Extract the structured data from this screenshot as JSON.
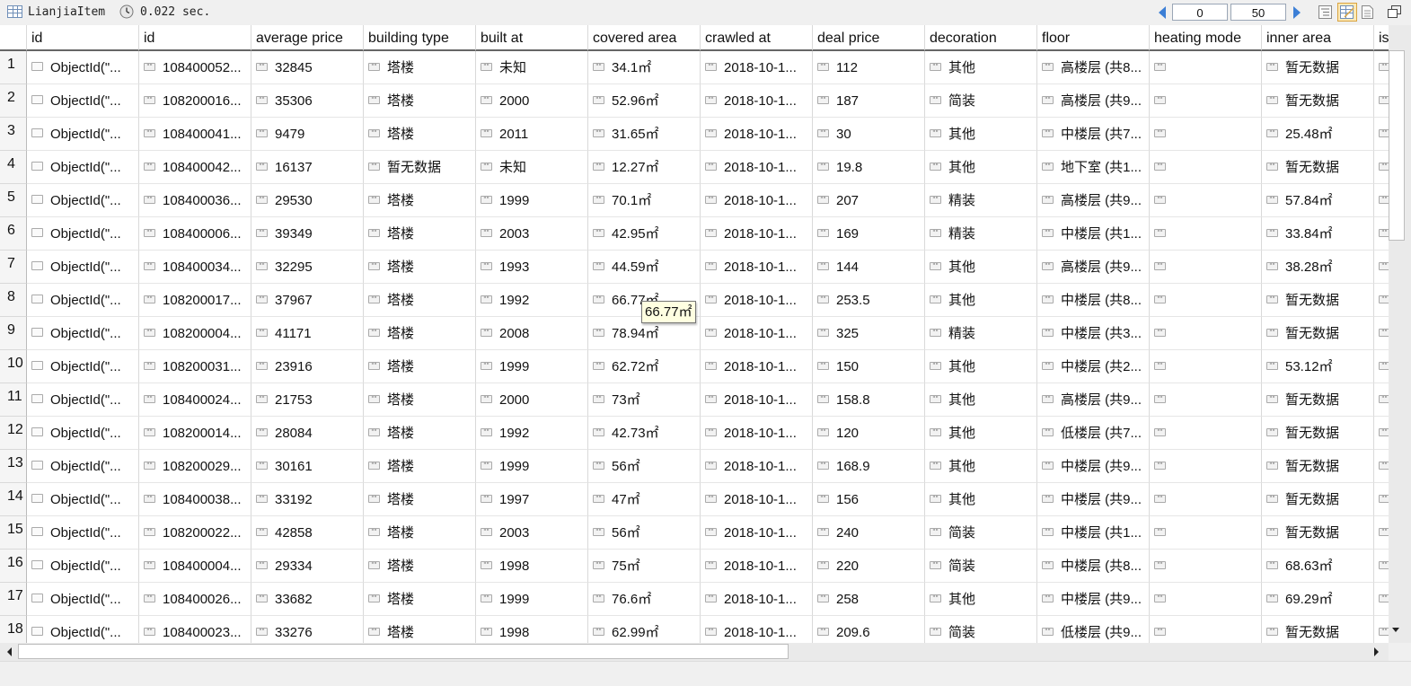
{
  "toolbar": {
    "collection_name": "LianjiaItem",
    "query_time": "0.022 sec.",
    "page_start": "0",
    "page_size": "50"
  },
  "columns": [
    "id",
    "id",
    "average price",
    "building type",
    "built at",
    "covered area",
    "crawled at",
    "deal price",
    "decoration",
    "floor",
    "heating mode",
    "inner area",
    "is"
  ],
  "rows": [
    [
      "ObjectId(\"...",
      "108400052...",
      "32845",
      "塔楼",
      "未知",
      "34.1㎡",
      "2018-10-1...",
      "112",
      "其他",
      "高楼层 (共8...",
      "",
      "暂无数据",
      ""
    ],
    [
      "ObjectId(\"...",
      "108200016...",
      "35306",
      "塔楼",
      "2000",
      "52.96㎡",
      "2018-10-1...",
      "187",
      "简装",
      "高楼层 (共9...",
      "",
      "暂无数据",
      ""
    ],
    [
      "ObjectId(\"...",
      "108400041...",
      "9479",
      "塔楼",
      "2011",
      "31.65㎡",
      "2018-10-1...",
      "30",
      "其他",
      "中楼层 (共7...",
      "",
      "25.48㎡",
      ""
    ],
    [
      "ObjectId(\"...",
      "108400042...",
      "16137",
      "暂无数据",
      "未知",
      "12.27㎡",
      "2018-10-1...",
      "19.8",
      "其他",
      "地下室 (共1...",
      "",
      "暂无数据",
      ""
    ],
    [
      "ObjectId(\"...",
      "108400036...",
      "29530",
      "塔楼",
      "1999",
      "70.1㎡",
      "2018-10-1...",
      "207",
      "精装",
      "高楼层 (共9...",
      "",
      "57.84㎡",
      ""
    ],
    [
      "ObjectId(\"...",
      "108400006...",
      "39349",
      "塔楼",
      "2003",
      "42.95㎡",
      "2018-10-1...",
      "169",
      "精装",
      "中楼层 (共1...",
      "",
      "33.84㎡",
      ""
    ],
    [
      "ObjectId(\"...",
      "108400034...",
      "32295",
      "塔楼",
      "1993",
      "44.59㎡",
      "2018-10-1...",
      "144",
      "其他",
      "高楼层 (共9...",
      "",
      "38.28㎡",
      ""
    ],
    [
      "ObjectId(\"...",
      "108200017...",
      "37967",
      "塔楼",
      "1992",
      "66.77㎡",
      "2018-10-1...",
      "253.5",
      "其他",
      "中楼层 (共8...",
      "",
      "暂无数据",
      ""
    ],
    [
      "ObjectId(\"...",
      "108200004...",
      "41171",
      "塔楼",
      "2008",
      "78.94㎡",
      "2018-10-1...",
      "325",
      "精装",
      "中楼层 (共3...",
      "",
      "暂无数据",
      ""
    ],
    [
      "ObjectId(\"...",
      "108200031...",
      "23916",
      "塔楼",
      "1999",
      "62.72㎡",
      "2018-10-1...",
      "150",
      "其他",
      "中楼层 (共2...",
      "",
      "53.12㎡",
      ""
    ],
    [
      "ObjectId(\"...",
      "108400024...",
      "21753",
      "塔楼",
      "2000",
      "73㎡",
      "2018-10-1...",
      "158.8",
      "其他",
      "高楼层 (共9...",
      "",
      "暂无数据",
      ""
    ],
    [
      "ObjectId(\"...",
      "108200014...",
      "28084",
      "塔楼",
      "1992",
      "42.73㎡",
      "2018-10-1...",
      "120",
      "其他",
      "低楼层 (共7...",
      "",
      "暂无数据",
      ""
    ],
    [
      "ObjectId(\"...",
      "108200029...",
      "30161",
      "塔楼",
      "1999",
      "56㎡",
      "2018-10-1...",
      "168.9",
      "其他",
      "中楼层 (共9...",
      "",
      "暂无数据",
      ""
    ],
    [
      "ObjectId(\"...",
      "108400038...",
      "33192",
      "塔楼",
      "1997",
      "47㎡",
      "2018-10-1...",
      "156",
      "其他",
      "中楼层 (共9...",
      "",
      "暂无数据",
      ""
    ],
    [
      "ObjectId(\"...",
      "108200022...",
      "42858",
      "塔楼",
      "2003",
      "56㎡",
      "2018-10-1...",
      "240",
      "简装",
      "中楼层 (共1...",
      "",
      "暂无数据",
      ""
    ],
    [
      "ObjectId(\"...",
      "108400004...",
      "29334",
      "塔楼",
      "1998",
      "75㎡",
      "2018-10-1...",
      "220",
      "简装",
      "中楼层 (共8...",
      "",
      "68.63㎡",
      ""
    ],
    [
      "ObjectId(\"...",
      "108400026...",
      "33682",
      "塔楼",
      "1999",
      "76.6㎡",
      "2018-10-1...",
      "258",
      "其他",
      "中楼层 (共9...",
      "",
      "69.29㎡",
      ""
    ],
    [
      "ObjectId(\"...",
      "108400023...",
      "33276",
      "塔楼",
      "1998",
      "62.99㎡",
      "2018-10-1...",
      "209.6",
      "简装",
      "低楼层 (共9...",
      "",
      "暂无数据",
      ""
    ]
  ],
  "tooltip": "66.77㎡",
  "icons": {
    "table": "table-icon",
    "clock": "clock-icon",
    "prev": "prev-page-icon",
    "next": "next-page-icon",
    "view_tree": "tree-view-icon",
    "view_table": "table-view-icon",
    "view_text": "text-view-icon",
    "restore": "restore-window-icon",
    "string_field": "string-field-icon",
    "object_field": "object-field-icon"
  },
  "colors": {
    "accent": "#3c7fd6",
    "header_border": "#666666"
  }
}
